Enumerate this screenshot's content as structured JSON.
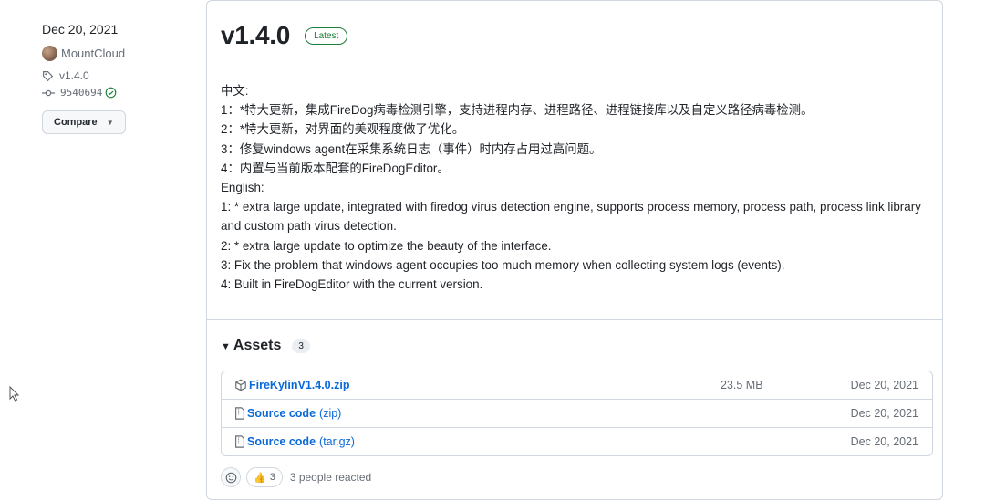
{
  "sidebar": {
    "date": "Dec 20, 2021",
    "author": "MountCloud",
    "tag": "v1.4.0",
    "commit": "9540694",
    "compare_label": "Compare"
  },
  "release": {
    "title": "v1.4.0",
    "badge": "Latest",
    "notes": [
      "中文:",
      "1：*特大更新，集成FireDog病毒检测引擎，支持进程内存、进程路径、进程链接库以及自定义路径病毒检测。",
      "2：*特大更新，对界面的美观程度做了优化。",
      "3：修复windows agent在采集系统日志（事件）时内存占用过高问题。",
      "4：内置与当前版本配套的FireDogEditor。",
      "English:",
      "1: * extra large update, integrated with firedog virus detection engine, supports process memory, process path, process link library and custom path virus detection.",
      "2: * extra large update to optimize the beauty of the interface.",
      "3: Fix the problem that windows agent occupies too much memory when collecting system logs (events).",
      "4: Built in FireDogEditor with the current version."
    ]
  },
  "assets": {
    "title": "Assets",
    "count": "3",
    "items": [
      {
        "name": "FireKylinV1.4.0.zip",
        "sub": "",
        "size": "23.5 MB",
        "date": "Dec 20, 2021",
        "icon": "package-icon"
      },
      {
        "name": "Source code",
        "sub": "(zip)",
        "size": "",
        "date": "Dec 20, 2021",
        "icon": "file-zip-icon"
      },
      {
        "name": "Source code",
        "sub": "(tar.gz)",
        "size": "",
        "date": "Dec 20, 2021",
        "icon": "file-zip-icon"
      }
    ]
  },
  "reactions": {
    "thumbs_count": "3",
    "summary": "3 people reacted"
  },
  "colors": {
    "link": "#0969da",
    "latest": "#1a7f37",
    "border": "#d0d7de"
  }
}
